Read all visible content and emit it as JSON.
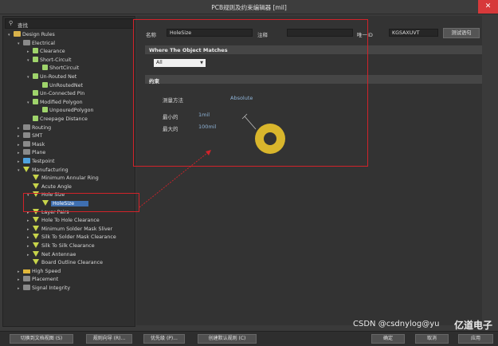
{
  "window": {
    "title": "PCB规则及约束编辑器 [mil]",
    "close_glyph": "✕"
  },
  "search": {
    "label": "查找"
  },
  "tree": [
    {
      "label": "Design Rules",
      "icon": "folder",
      "arrow": "▾"
    },
    {
      "label": "Electrical",
      "icon": "gray",
      "arrow": "▾"
    },
    {
      "label": "Clearance",
      "icon": "rule2",
      "arrow": "▸"
    },
    {
      "label": "Short-Circuit",
      "icon": "rule2",
      "arrow": "▾"
    },
    {
      "label": "ShortCircuit",
      "icon": "rule2",
      "arrow": ""
    },
    {
      "label": "Un-Routed Net",
      "icon": "rule2",
      "arrow": "▾"
    },
    {
      "label": "UnRoutedNet",
      "icon": "rule2",
      "arrow": ""
    },
    {
      "label": "Un-Connected Pin",
      "icon": "rule2",
      "arrow": ""
    },
    {
      "label": "Modified Polygon",
      "icon": "rule2",
      "arrow": "▾"
    },
    {
      "label": "UnpouredPolygon",
      "icon": "rule2",
      "arrow": ""
    },
    {
      "label": "Creepage Distance",
      "icon": "rule2",
      "arrow": ""
    },
    {
      "label": "Routing",
      "icon": "gray",
      "arrow": "▸"
    },
    {
      "label": "SMT",
      "icon": "gray",
      "arrow": "▸"
    },
    {
      "label": "Mask",
      "icon": "gray",
      "arrow": "▸"
    },
    {
      "label": "Plane",
      "icon": "gray",
      "arrow": "▸"
    },
    {
      "label": "Testpoint",
      "icon": "blue",
      "arrow": "▸"
    },
    {
      "label": "Manufacturing",
      "icon": "rule",
      "arrow": "▾"
    },
    {
      "label": "Minimum Annular Ring",
      "icon": "rule",
      "arrow": ""
    },
    {
      "label": "Acute Angle",
      "icon": "rule",
      "arrow": ""
    },
    {
      "label": "Hole Size",
      "icon": "rule",
      "arrow": "▾"
    },
    {
      "label": "HoleSize",
      "icon": "rule",
      "arrow": "",
      "selected": true
    },
    {
      "label": "Layer Pairs",
      "icon": "rule",
      "arrow": "▸"
    },
    {
      "label": "Hole To Hole Clearance",
      "icon": "rule",
      "arrow": "▸"
    },
    {
      "label": "Minimum Solder Mask Sliver",
      "icon": "rule",
      "arrow": "▸"
    },
    {
      "label": "Silk To Solder Mask Clearance",
      "icon": "rule",
      "arrow": "▸"
    },
    {
      "label": "Silk To Silk Clearance",
      "icon": "rule",
      "arrow": "▸"
    },
    {
      "label": "Net Antennae",
      "icon": "rule",
      "arrow": "▸"
    },
    {
      "label": "Board Outline Clearance",
      "icon": "rule",
      "arrow": ""
    },
    {
      "label": "High Speed",
      "icon": "yellowbar",
      "arrow": "▸"
    },
    {
      "label": "Placement",
      "icon": "gray",
      "arrow": "▸"
    },
    {
      "label": "Signal Integrity",
      "icon": "gray",
      "arrow": "▸"
    }
  ],
  "form": {
    "name_label": "名称",
    "name_value": "HoleSize",
    "comment_label": "注释",
    "comment_value": "",
    "id_label": "唯一ID",
    "id_value": "KGSAXUVT",
    "test_button": "测试语句",
    "where_title": "Where The Object Matches",
    "where_value": "All",
    "constraints_title": "约束",
    "measure_label": "测量方法",
    "measure_value": "Absolute",
    "min_label": "最小的",
    "min_value": "1mil",
    "max_label": "最大的",
    "max_value": "100mil"
  },
  "bottom": {
    "btn1": "切换到文档视图 (S)",
    "btn2": "规则向导 (R)...",
    "btn3": "优先级 (P)...",
    "btn4": "创建默认规则 (C)",
    "ok": "确定",
    "cancel": "取消",
    "apply": "应用"
  },
  "watermark": {
    "csdn": "CSDN @csdnylog@yu",
    "brand": "亿道电子"
  },
  "colors": {
    "accent_red": "#d1232a",
    "ring_yellow": "#d9b62c",
    "selection": "#3f6fb0"
  }
}
